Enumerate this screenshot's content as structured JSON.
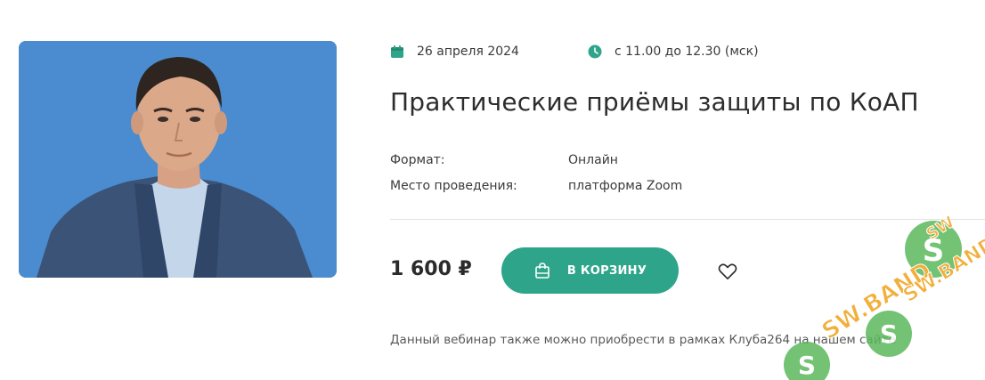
{
  "event": {
    "date": "26 апреля 2024",
    "time": "с 11.00 до 12.30 (мск)",
    "title": "Практические приёмы защиты по КоАП",
    "details": [
      {
        "label": "Формат:",
        "value": "Онлайн"
      },
      {
        "label": "Место проведения:",
        "value": "платформа Zoom"
      }
    ],
    "price": "1 600 ₽",
    "cart_button_label": "В КОРЗИНУ",
    "note": "Данный вебинар также можно приобрести в рамках Клуба264 на нашем сайте"
  },
  "icons": {
    "date": "calendar-icon",
    "time": "clock-icon",
    "cart": "shopping-bag-icon",
    "favorite": "heart-icon"
  },
  "watermark_text": "SW.BAND",
  "colors": {
    "accent": "#2ea58a",
    "photo_background": "#4a8ccf",
    "text": "#2b2b2b"
  }
}
